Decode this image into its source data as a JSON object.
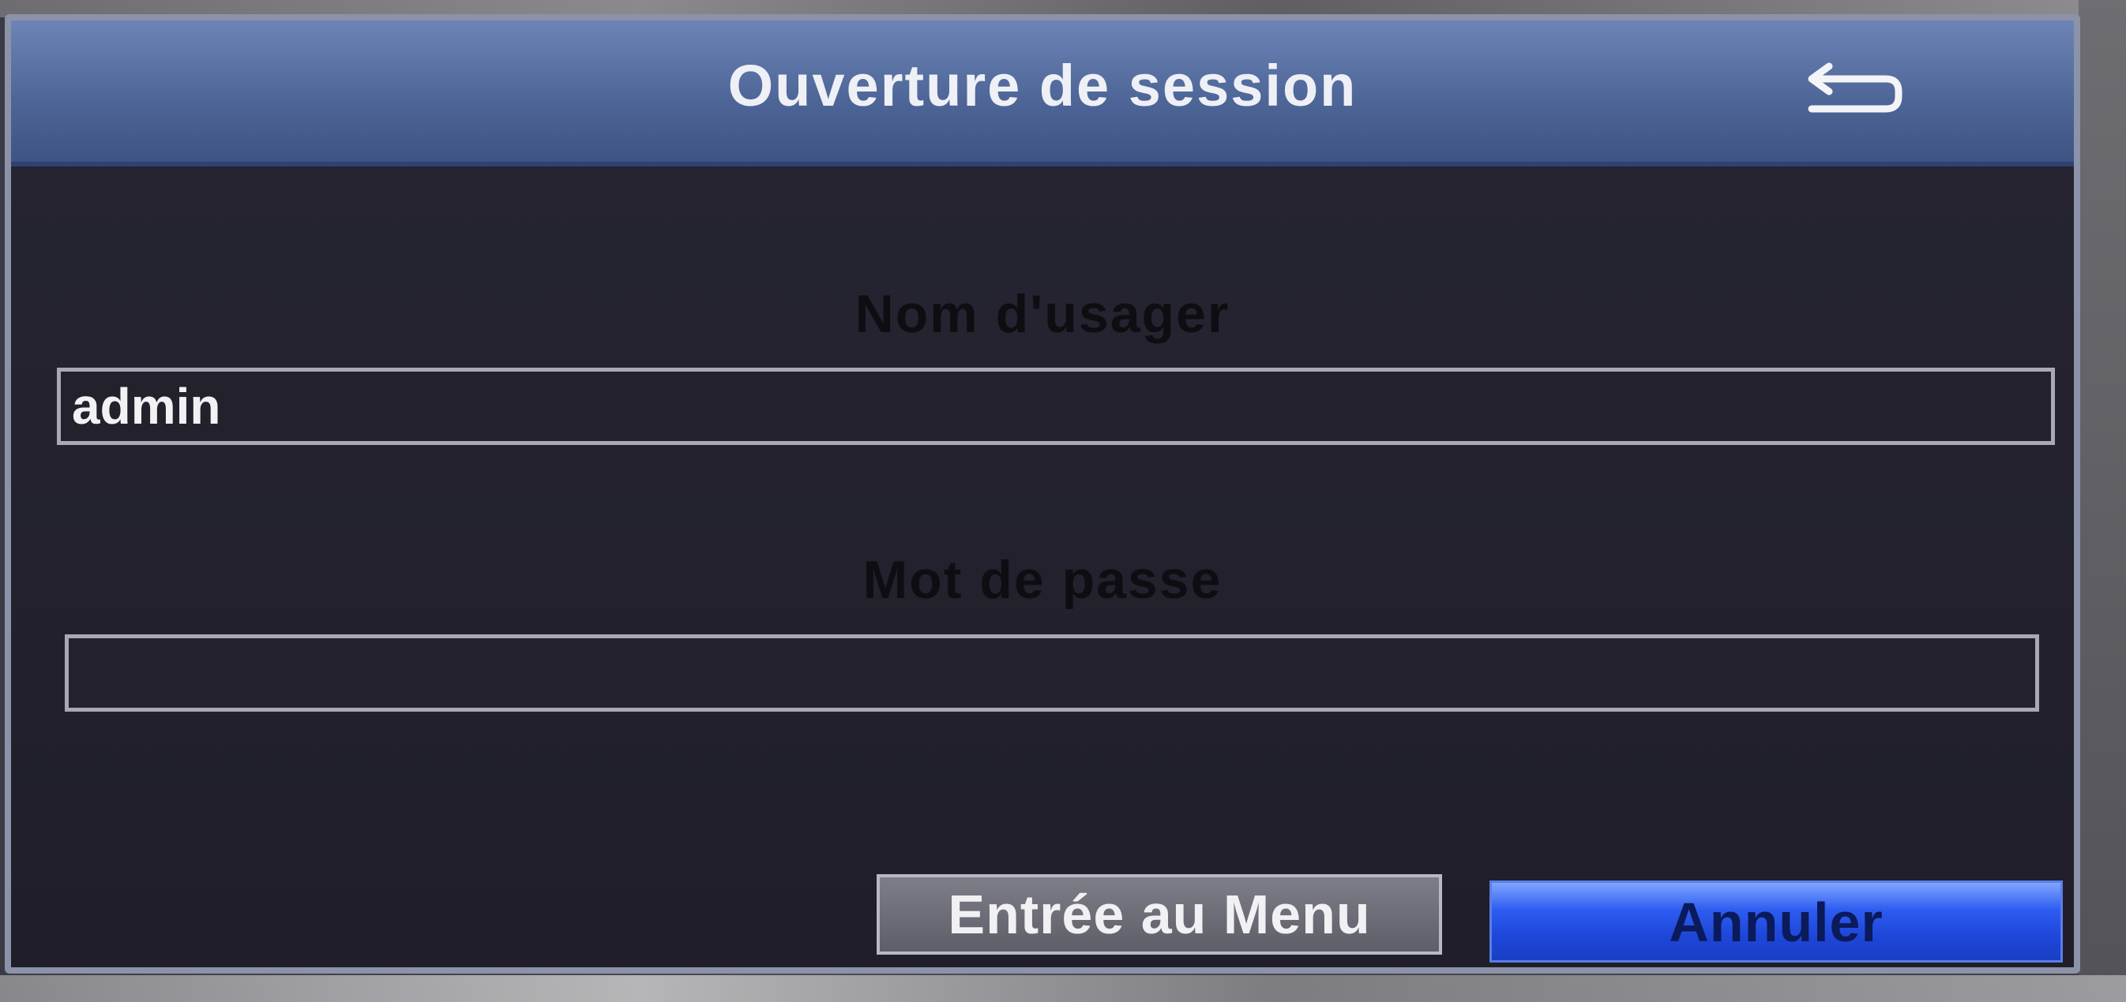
{
  "dialog": {
    "title": "Ouverture de session",
    "back_icon": "return-arrow-icon"
  },
  "username": {
    "label": "Nom d'usager",
    "value": "admin"
  },
  "password": {
    "label": "Mot de passe",
    "value": ""
  },
  "buttons": {
    "enter_menu": "Entrée au Menu",
    "cancel": "Annuler"
  },
  "colors": {
    "titlebar": "#4e6698",
    "dialog_bg": "#23222e",
    "cancel_accent": "#2d5cf0",
    "enter_bg": "#6d6e77"
  }
}
